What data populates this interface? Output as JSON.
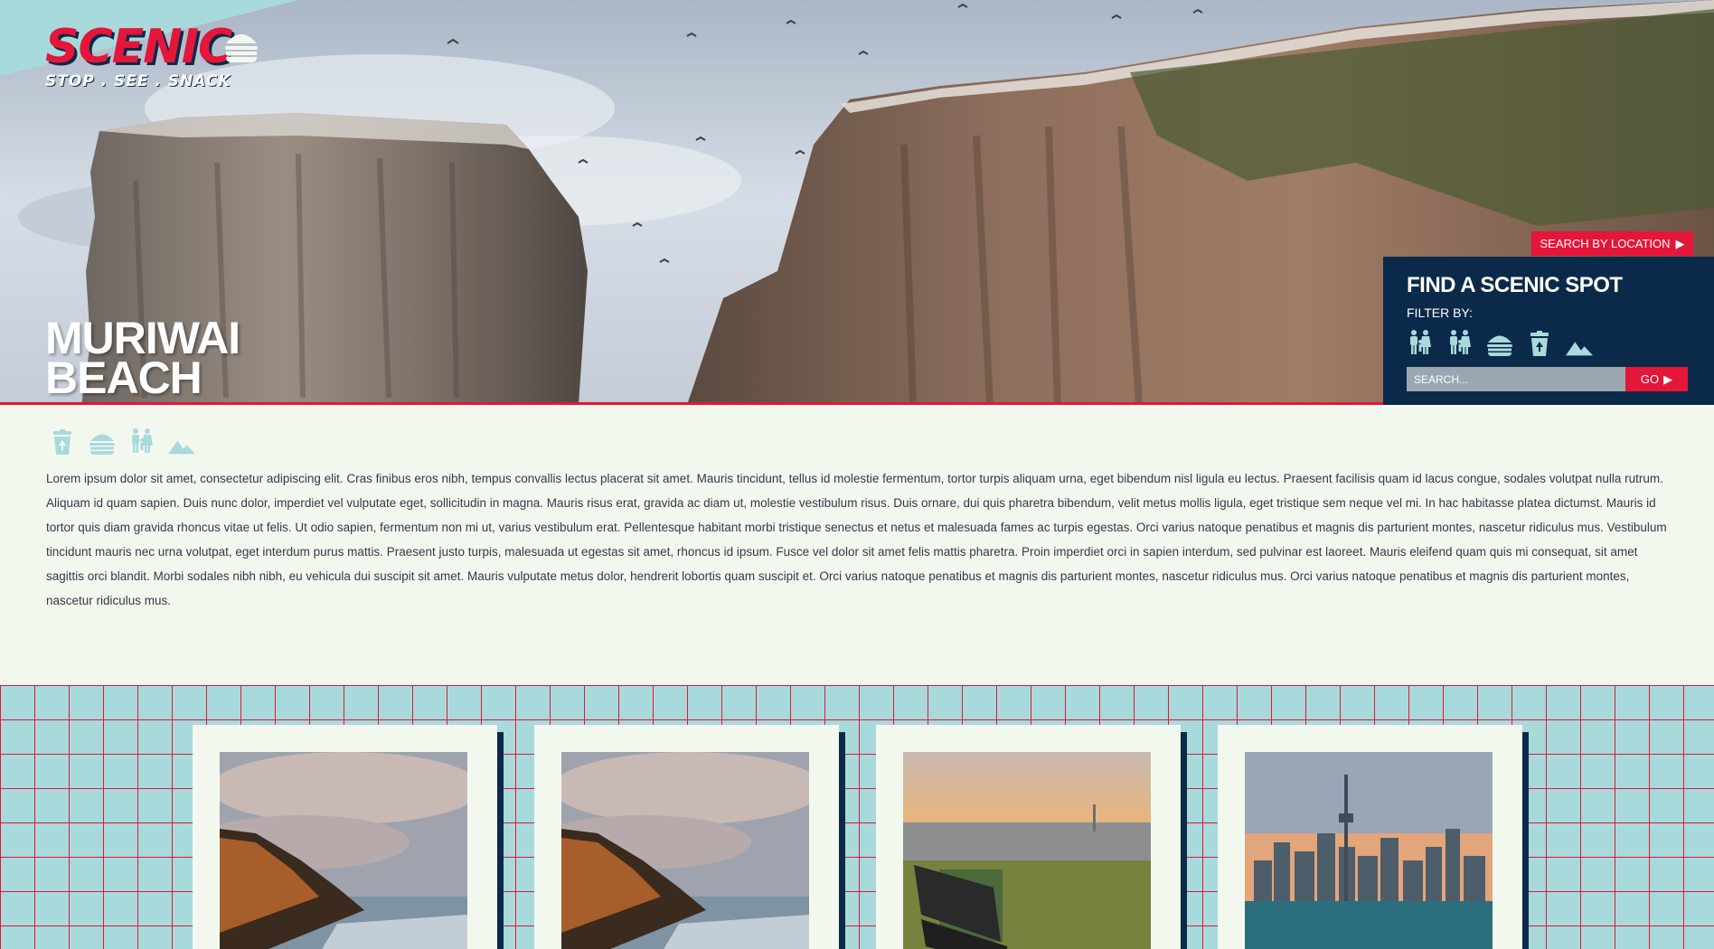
{
  "logo": {
    "word": "SCENIC",
    "tagline": "STOP . SEE . SNACK"
  },
  "hero": {
    "title_line1": "MURIWAI",
    "title_line2": "BEACH"
  },
  "finder": {
    "location_button": "SEARCH BY LOCATION",
    "title": "FIND A SCENIC SPOT",
    "filter_label": "FILTER BY:",
    "filter_icons": [
      "family-icon",
      "family-icon",
      "burger-icon",
      "trash-bin-icon",
      "mountain-icon"
    ],
    "search_placeholder": "SEARCH...",
    "go_label": "GO"
  },
  "location": {
    "amenity_icons": [
      "trash-bin-icon",
      "burger-icon",
      "family-icon",
      "mountain-icon"
    ],
    "description": "Lorem ipsum dolor sit amet, consectetur adipiscing elit. Cras finibus eros nibh, tempus convallis lectus placerat sit amet. Mauris tincidunt, tellus id molestie fermentum, tortor turpis aliquam urna, eget bibendum nisl ligula eu lectus. Praesent facilisis quam id lacus congue, sodales volutpat nulla rutrum. Aliquam id quam sapien. Duis nunc dolor, imperdiet vel vulputate eget, sollicitudin in magna. Mauris risus erat, gravida ac diam ut, molestie vestibulum risus. Duis ornare, dui quis pharetra bibendum, velit metus mollis ligula, eget tristique sem neque vel mi. In hac habitasse platea dictumst. Mauris id tortor quis diam gravida rhoncus vitae ut felis. Ut odio sapien, fermentum non mi ut, varius vestibulum erat. Pellentesque habitant morbi tristique senectus et netus et malesuada fames ac turpis egestas. Orci varius natoque penatibus et magnis dis parturient montes, nascetur ridiculus mus. Vestibulum tincidunt mauris nec urna volutpat, eget interdum purus mattis. Praesent justo turpis, malesuada ut egestas sit amet, rhoncus id ipsum. Fusce vel dolor sit amet felis mattis pharetra. Proin imperdiet orci in sapien interdum, sed pulvinar est laoreet. Mauris eleifend quam quis mi consequat, sit amet sagittis orci blandit. Morbi sodales nibh nibh, eu vehicula dui suscipit sit amet. Mauris vulputate metus dolor, hendrerit lobortis quam suscipit et. Orci varius natoque penatibus et magnis dis parturient montes, nascetur ridiculus mus. Orci varius natoque penatibus et magnis dis parturient montes, nascetur ridiculus mus."
  },
  "cards": [
    {
      "image": "coastal-cliff-photo"
    },
    {
      "image": "coastal-cliff-photo"
    },
    {
      "image": "city-bench-sunset-photo"
    },
    {
      "image": "city-skyline-tower-photo"
    }
  ],
  "colors": {
    "red": "#e4163a",
    "navy": "#0b2a4a",
    "teal": "#a8dadc",
    "cream": "#f3f8ef"
  }
}
